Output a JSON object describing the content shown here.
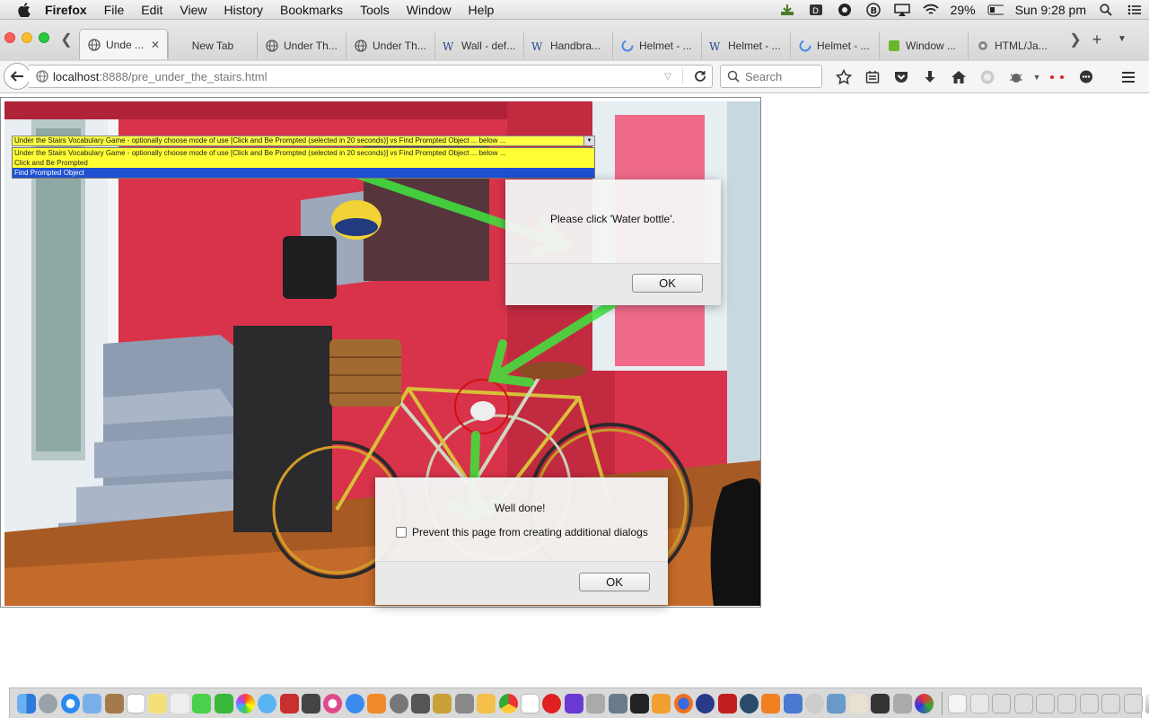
{
  "menubar": {
    "app_name": "Firefox",
    "menus": [
      "File",
      "Edit",
      "View",
      "History",
      "Bookmarks",
      "Tools",
      "Window",
      "Help"
    ],
    "battery": "29%",
    "clock": "Sun 9:28 pm"
  },
  "tabs": [
    {
      "label": "Unde ...",
      "icon": "globe-icon",
      "active": true,
      "closable": true
    },
    {
      "label": "New Tab",
      "icon": "",
      "active": false
    },
    {
      "label": "Under Th...",
      "icon": "globe-icon",
      "active": false
    },
    {
      "label": "Under Th...",
      "icon": "globe-icon",
      "active": false
    },
    {
      "label": "Wall - def...",
      "icon": "wiki-icon",
      "active": false
    },
    {
      "label": "Handbra...",
      "icon": "wiki-icon",
      "active": false
    },
    {
      "label": "Helmet - ...",
      "icon": "loading-icon",
      "active": false
    },
    {
      "label": "Helmet - ...",
      "icon": "wiki-icon",
      "active": false
    },
    {
      "label": "Helmet - ...",
      "icon": "loading-icon",
      "active": false
    },
    {
      "label": "Window ...",
      "icon": "green-site-icon",
      "active": false
    },
    {
      "label": "HTML/Ja...",
      "icon": "gear-site-icon",
      "active": false
    }
  ],
  "navbar": {
    "url_host": "localhost",
    "url_rest": ":8888/pre_under_the_stairs.html",
    "search_placeholder": "Search"
  },
  "page": {
    "select": {
      "selected_text": "Under the Stairs Vocabulary Game - optionally choose mode of use [Click and Be Prompted (selected in 20 seconds)] vs Find Prompted Object ... below ...",
      "options": [
        "Under the Stairs Vocabulary Game - optionally choose mode of use [Click and Be Prompted (selected in 20 seconds)] vs Find Prompted Object ... below ...",
        "Click and Be Prompted",
        "Find Prompted Object"
      ],
      "highlighted_index": 2
    },
    "dialog_prompt": {
      "message": "Please click 'Water bottle'.",
      "ok_label": "OK"
    },
    "dialog_done": {
      "message": "Well done!",
      "checkbox_label": "Prevent this page from creating additional dialogs",
      "ok_label": "OK"
    }
  },
  "colors": {
    "arrow": "#3ee63e",
    "select_bg": "#ffff33",
    "select_highlight": "#1e50d0",
    "target_circle": "#d21010"
  }
}
